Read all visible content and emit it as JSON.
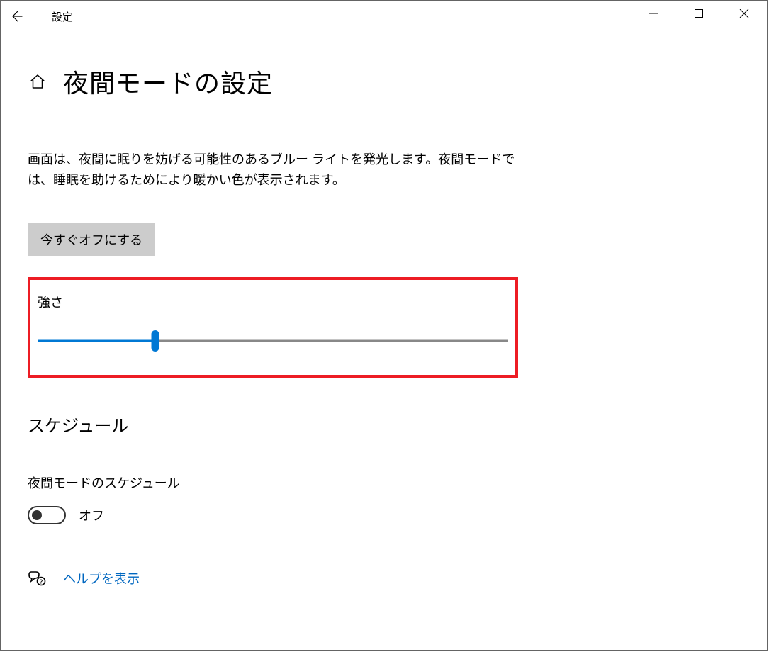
{
  "window": {
    "app_title": "設定"
  },
  "page": {
    "title": "夜間モードの設定",
    "description_line1": "画面は、夜間に眠りを妨げる可能性のあるブルー ライトを発光します。夜間モードで",
    "description_line2": "は、睡眠を助けるためにより暖かい色が表示されます。",
    "turn_off_button": "今すぐオフにする",
    "strength_label": "強さ",
    "slider_percent": 25,
    "schedule_heading": "スケジュール",
    "schedule_label": "夜間モードのスケジュール",
    "toggle_state": "オフ",
    "help_link": "ヘルプを表示"
  },
  "colors": {
    "accent": "#0078d4",
    "link": "#0067c0",
    "highlight": "#ed1c24"
  }
}
